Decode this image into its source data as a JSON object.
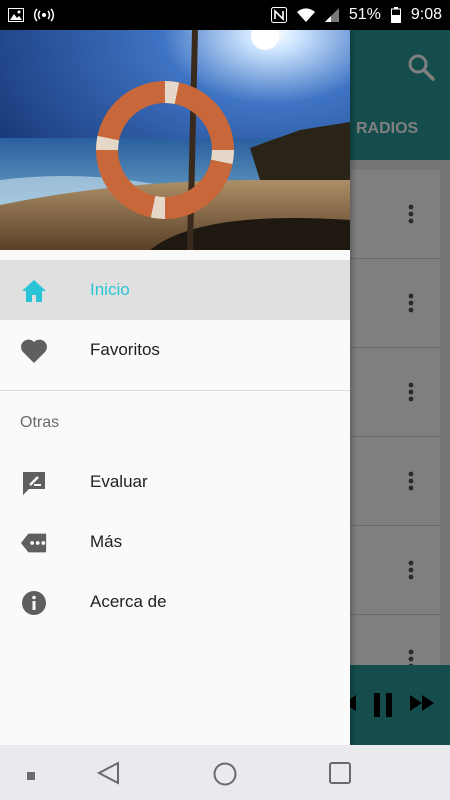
{
  "status_bar": {
    "battery": "51%",
    "time": "9:08"
  },
  "app": {
    "tab_label": "RADIOS"
  },
  "drawer": {
    "items": [
      {
        "label": "Inicio",
        "icon": "home-icon",
        "active": true
      },
      {
        "label": "Favoritos",
        "icon": "heart-icon",
        "active": false
      }
    ],
    "section_title": "Otras",
    "other_items": [
      {
        "label": "Evaluar",
        "icon": "rate-review-icon"
      },
      {
        "label": "Más",
        "icon": "more-tag-icon"
      },
      {
        "label": "Acerca de",
        "icon": "info-icon"
      }
    ]
  },
  "colors": {
    "accent": "#29c5d6",
    "toolbar": "#2a9b9b"
  }
}
